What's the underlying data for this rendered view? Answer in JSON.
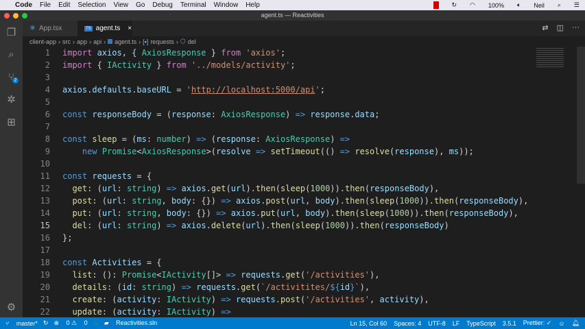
{
  "menubar": {
    "app": "Code",
    "items": [
      "File",
      "Edit",
      "Selection",
      "View",
      "Go",
      "Debug",
      "Terminal",
      "Window",
      "Help"
    ],
    "battery": "100%",
    "user": "Neil"
  },
  "window": {
    "title": "agent.ts — Reactivities"
  },
  "tabs": [
    {
      "label": "App.tsx",
      "icon": "react-icon"
    },
    {
      "label": "agent.ts",
      "icon": "typescript-icon",
      "close": "×"
    }
  ],
  "breadcrumb": [
    "client-app",
    "src",
    "app",
    "api",
    "agent.ts",
    "requests",
    "del"
  ],
  "editor": {
    "current_line": 15,
    "lines": [
      [
        [
          "import",
          "k"
        ],
        [
          " axios, { ",
          "v"
        ],
        [
          "AxiosResponse",
          "t"
        ],
        [
          " } ",
          "p"
        ],
        [
          "from",
          "k"
        ],
        [
          " ",
          "p"
        ],
        [
          "'axios'",
          "s"
        ],
        [
          ";",
          "p"
        ]
      ],
      [
        [
          "import",
          "k"
        ],
        [
          " { ",
          "p"
        ],
        [
          "IActivity",
          "t"
        ],
        [
          " } ",
          "p"
        ],
        [
          "from",
          "k"
        ],
        [
          " ",
          "p"
        ],
        [
          "'../models/activity'",
          "s"
        ],
        [
          ";",
          "p"
        ]
      ],
      [],
      [
        [
          "axios",
          "v"
        ],
        [
          ".",
          "p"
        ],
        [
          "defaults",
          "v"
        ],
        [
          ".",
          "p"
        ],
        [
          "baseURL",
          "v"
        ],
        [
          " = ",
          "p"
        ],
        [
          "'",
          "s"
        ],
        [
          "http://localhost:5000/api",
          "u"
        ],
        [
          "'",
          "s"
        ],
        [
          ";",
          "p"
        ]
      ],
      [],
      [
        [
          "const",
          "b"
        ],
        [
          " ",
          "p"
        ],
        [
          "responseBody",
          "v"
        ],
        [
          " = (",
          "p"
        ],
        [
          "response",
          "v"
        ],
        [
          ": ",
          "p"
        ],
        [
          "AxiosResponse",
          "t"
        ],
        [
          ") ",
          "p"
        ],
        [
          "=>",
          "b"
        ],
        [
          " ",
          "p"
        ],
        [
          "response",
          "v"
        ],
        [
          ".",
          "p"
        ],
        [
          "data",
          "v"
        ],
        [
          ";",
          "p"
        ]
      ],
      [],
      [
        [
          "const",
          "b"
        ],
        [
          " ",
          "p"
        ],
        [
          "sleep",
          "f"
        ],
        [
          " = (",
          "p"
        ],
        [
          "ms",
          "v"
        ],
        [
          ": ",
          "p"
        ],
        [
          "number",
          "t"
        ],
        [
          ") ",
          "p"
        ],
        [
          "=>",
          "b"
        ],
        [
          " (",
          "p"
        ],
        [
          "response",
          "v"
        ],
        [
          ": ",
          "p"
        ],
        [
          "AxiosResponse",
          "t"
        ],
        [
          ") ",
          "p"
        ],
        [
          "=>",
          "b"
        ]
      ],
      [
        [
          "    ",
          "p"
        ],
        [
          "new",
          "b"
        ],
        [
          " ",
          "p"
        ],
        [
          "Promise",
          "t"
        ],
        [
          "<",
          "p"
        ],
        [
          "AxiosResponse",
          "t"
        ],
        [
          ">(",
          "p"
        ],
        [
          "resolve",
          "v"
        ],
        [
          " ",
          "p"
        ],
        [
          "=>",
          "b"
        ],
        [
          " ",
          "p"
        ],
        [
          "setTimeout",
          "f"
        ],
        [
          "(() ",
          "p"
        ],
        [
          "=>",
          "b"
        ],
        [
          " ",
          "p"
        ],
        [
          "resolve",
          "f"
        ],
        [
          "(",
          "p"
        ],
        [
          "response",
          "v"
        ],
        [
          "), ",
          "p"
        ],
        [
          "ms",
          "v"
        ],
        [
          "));",
          "p"
        ]
      ],
      [],
      [
        [
          "const",
          "b"
        ],
        [
          " ",
          "p"
        ],
        [
          "requests",
          "v"
        ],
        [
          " = {",
          "p"
        ]
      ],
      [
        [
          "  ",
          "p"
        ],
        [
          "get",
          "f"
        ],
        [
          ": (",
          "p"
        ],
        [
          "url",
          "v"
        ],
        [
          ": ",
          "p"
        ],
        [
          "string",
          "t"
        ],
        [
          ") ",
          "p"
        ],
        [
          "=>",
          "b"
        ],
        [
          " ",
          "p"
        ],
        [
          "axios",
          "v"
        ],
        [
          ".",
          "p"
        ],
        [
          "get",
          "f"
        ],
        [
          "(",
          "p"
        ],
        [
          "url",
          "v"
        ],
        [
          ").",
          "p"
        ],
        [
          "then",
          "f"
        ],
        [
          "(",
          "p"
        ],
        [
          "sleep",
          "f"
        ],
        [
          "(",
          "p"
        ],
        [
          "1000",
          "n"
        ],
        [
          ")).",
          "p"
        ],
        [
          "then",
          "f"
        ],
        [
          "(",
          "p"
        ],
        [
          "responseBody",
          "v"
        ],
        [
          "),",
          "p"
        ]
      ],
      [
        [
          "  ",
          "p"
        ],
        [
          "post",
          "f"
        ],
        [
          ": (",
          "p"
        ],
        [
          "url",
          "v"
        ],
        [
          ": ",
          "p"
        ],
        [
          "string",
          "t"
        ],
        [
          ", ",
          "p"
        ],
        [
          "body",
          "v"
        ],
        [
          ": {}) ",
          "p"
        ],
        [
          "=>",
          "b"
        ],
        [
          " ",
          "p"
        ],
        [
          "axios",
          "v"
        ],
        [
          ".",
          "p"
        ],
        [
          "post",
          "f"
        ],
        [
          "(",
          "p"
        ],
        [
          "url",
          "v"
        ],
        [
          ", ",
          "p"
        ],
        [
          "body",
          "v"
        ],
        [
          ").",
          "p"
        ],
        [
          "then",
          "f"
        ],
        [
          "(",
          "p"
        ],
        [
          "sleep",
          "f"
        ],
        [
          "(",
          "p"
        ],
        [
          "1000",
          "n"
        ],
        [
          ")).",
          "p"
        ],
        [
          "then",
          "f"
        ],
        [
          "(",
          "p"
        ],
        [
          "responseBody",
          "v"
        ],
        [
          "),",
          "p"
        ]
      ],
      [
        [
          "  ",
          "p"
        ],
        [
          "put",
          "f"
        ],
        [
          ": (",
          "p"
        ],
        [
          "url",
          "v"
        ],
        [
          ": ",
          "p"
        ],
        [
          "string",
          "t"
        ],
        [
          ", ",
          "p"
        ],
        [
          "body",
          "v"
        ],
        [
          ": {}) ",
          "p"
        ],
        [
          "=>",
          "b"
        ],
        [
          " ",
          "p"
        ],
        [
          "axios",
          "v"
        ],
        [
          ".",
          "p"
        ],
        [
          "put",
          "f"
        ],
        [
          "(",
          "p"
        ],
        [
          "url",
          "v"
        ],
        [
          ", ",
          "p"
        ],
        [
          "body",
          "v"
        ],
        [
          ").",
          "p"
        ],
        [
          "then",
          "f"
        ],
        [
          "(",
          "p"
        ],
        [
          "sleep",
          "f"
        ],
        [
          "(",
          "p"
        ],
        [
          "1000",
          "n"
        ],
        [
          ")).",
          "p"
        ],
        [
          "then",
          "f"
        ],
        [
          "(",
          "p"
        ],
        [
          "responseBody",
          "v"
        ],
        [
          "),",
          "p"
        ]
      ],
      [
        [
          "  ",
          "p"
        ],
        [
          "del",
          "f"
        ],
        [
          ": (",
          "p"
        ],
        [
          "url",
          "v"
        ],
        [
          ": ",
          "p"
        ],
        [
          "string",
          "t"
        ],
        [
          ") ",
          "p"
        ],
        [
          "=>",
          "b"
        ],
        [
          " ",
          "p"
        ],
        [
          "axios",
          "v"
        ],
        [
          ".",
          "p"
        ],
        [
          "delete",
          "f"
        ],
        [
          "(",
          "p"
        ],
        [
          "url",
          "v"
        ],
        [
          ").",
          "p"
        ],
        [
          "then",
          "f"
        ],
        [
          "(",
          "p"
        ],
        [
          "sleep",
          "f"
        ],
        [
          "(",
          "p"
        ],
        [
          "1000",
          "n"
        ],
        [
          ")).",
          "p"
        ],
        [
          "then",
          "f"
        ],
        [
          "(",
          "p"
        ],
        [
          "responseBody",
          "v"
        ],
        [
          ")",
          "p"
        ]
      ],
      [
        [
          "};",
          "p"
        ]
      ],
      [],
      [
        [
          "const",
          "b"
        ],
        [
          " ",
          "p"
        ],
        [
          "Activities",
          "v"
        ],
        [
          " = {",
          "p"
        ]
      ],
      [
        [
          "  ",
          "p"
        ],
        [
          "list",
          "f"
        ],
        [
          ": (): ",
          "p"
        ],
        [
          "Promise",
          "t"
        ],
        [
          "<",
          "p"
        ],
        [
          "IActivity",
          "t"
        ],
        [
          "[]> ",
          "p"
        ],
        [
          "=>",
          "b"
        ],
        [
          " ",
          "p"
        ],
        [
          "requests",
          "v"
        ],
        [
          ".",
          "p"
        ],
        [
          "get",
          "f"
        ],
        [
          "(",
          "p"
        ],
        [
          "'/activities'",
          "s"
        ],
        [
          "),",
          "p"
        ]
      ],
      [
        [
          "  ",
          "p"
        ],
        [
          "details",
          "f"
        ],
        [
          ": (",
          "p"
        ],
        [
          "id",
          "v"
        ],
        [
          ": ",
          "p"
        ],
        [
          "string",
          "t"
        ],
        [
          ") ",
          "p"
        ],
        [
          "=>",
          "b"
        ],
        [
          " ",
          "p"
        ],
        [
          "requests",
          "v"
        ],
        [
          ".",
          "p"
        ],
        [
          "get",
          "f"
        ],
        [
          "(",
          "p"
        ],
        [
          "`/activitites/",
          "s"
        ],
        [
          "${",
          "b"
        ],
        [
          "id",
          "v"
        ],
        [
          "}",
          "b"
        ],
        [
          "`",
          "s"
        ],
        [
          "),",
          "p"
        ]
      ],
      [
        [
          "  ",
          "p"
        ],
        [
          "create",
          "f"
        ],
        [
          ": (",
          "p"
        ],
        [
          "activity",
          "v"
        ],
        [
          ": ",
          "p"
        ],
        [
          "IActivity",
          "t"
        ],
        [
          ") ",
          "p"
        ],
        [
          "=>",
          "b"
        ],
        [
          " ",
          "p"
        ],
        [
          "requests",
          "v"
        ],
        [
          ".",
          "p"
        ],
        [
          "post",
          "f"
        ],
        [
          "(",
          "p"
        ],
        [
          "'/activities'",
          "s"
        ],
        [
          ", ",
          "p"
        ],
        [
          "activity",
          "v"
        ],
        [
          "),",
          "p"
        ]
      ],
      [
        [
          "  ",
          "p"
        ],
        [
          "update",
          "f"
        ],
        [
          ": (",
          "p"
        ],
        [
          "activity",
          "v"
        ],
        [
          ": ",
          "p"
        ],
        [
          "IActivity",
          "t"
        ],
        [
          ") ",
          "p"
        ],
        [
          "=>",
          "b"
        ]
      ]
    ]
  },
  "status": {
    "branch": "master*",
    "errors": "0",
    "warnings": "0",
    "solution": "Reactivities.sln",
    "position": "Ln 15, Col 60",
    "spaces": "Spaces: 4",
    "encoding": "UTF-8",
    "eol": "LF",
    "language": "TypeScript",
    "version": "3.5.1",
    "prettier": "Prettier: ✓"
  }
}
